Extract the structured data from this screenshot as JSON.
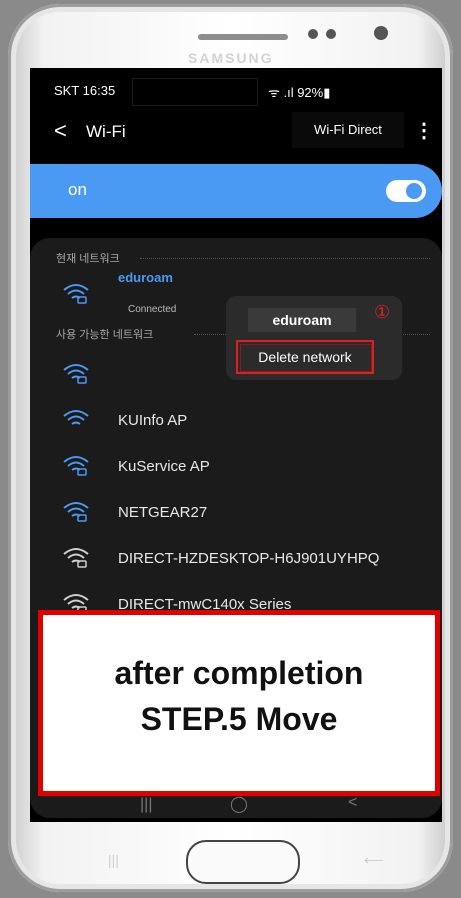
{
  "device": {
    "brand": "SAMSUNG"
  },
  "status_bar": {
    "time": "SKT 16:35",
    "indicators": "ᯤ .ıl 92%▮"
  },
  "header": {
    "back_glyph": "<",
    "title": "Wi-Fi",
    "wifi_direct": "Wi-Fi Direct",
    "more_glyph": "⋮"
  },
  "wifi_toggle": {
    "label": "on",
    "state": true
  },
  "current_network": {
    "section_title": "현재 네트워크",
    "name": "eduroam",
    "status": "Connected"
  },
  "available": {
    "section_title": "사용 가능한 네트워크",
    "networks": [
      {
        "name": "",
        "secured": true
      },
      {
        "name": "KUInfo AP",
        "secured": false
      },
      {
        "name": "KuService AP",
        "secured": true
      },
      {
        "name": "NETGEAR27",
        "secured": true
      },
      {
        "name": "DIRECT-HZDESKTOP-H6J901UYHPQ",
        "secured": true
      },
      {
        "name": "DIRECT-mwC140x Series",
        "secured": true
      }
    ]
  },
  "popup": {
    "network": "eduroam",
    "action": "Delete network",
    "marker": "①"
  },
  "nav": {
    "recent": "|||",
    "home": "◯",
    "back": "<"
  },
  "overlay": {
    "line1": "after completion",
    "line2": "STEP.5 Move"
  },
  "colors": {
    "accent": "#4a9af3",
    "highlight": "#e02020"
  }
}
